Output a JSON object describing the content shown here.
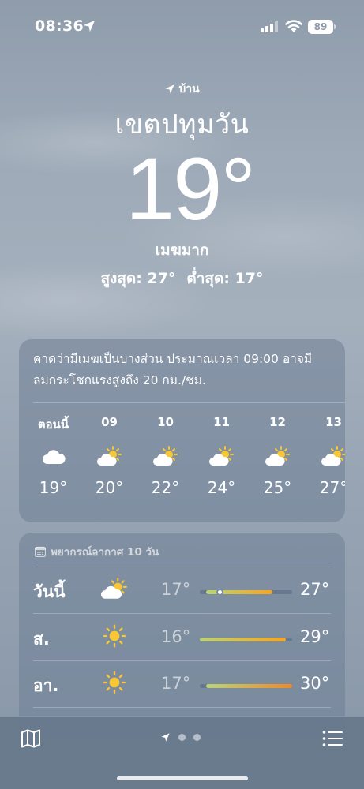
{
  "status_bar": {
    "time": "08:36",
    "battery": "89"
  },
  "header": {
    "location_label": "บ้าน",
    "city": "เขตปทุมวัน",
    "temperature": "19°",
    "condition": "เมฆมาก",
    "high": "สูงสุด: 27°",
    "low": "ต่ำสุด: 17°"
  },
  "hourly": {
    "summary_line1": "คาดว่ามีเมฆเป็นบางส่วน ประมาณเวลา 09:00 อาจมี",
    "summary_line2": "ลมกระโชกแรงสูงถึง 20 กม./ชม.",
    "hours": [
      {
        "label": "ตอนนี้",
        "icon": "cloud-icon",
        "temp": "19°"
      },
      {
        "label": "09",
        "icon": "partly-cloudy-icon",
        "temp": "20°"
      },
      {
        "label": "10",
        "icon": "partly-cloudy-icon",
        "temp": "22°"
      },
      {
        "label": "11",
        "icon": "partly-cloudy-icon",
        "temp": "24°"
      },
      {
        "label": "12",
        "icon": "partly-cloudy-icon",
        "temp": "25°"
      },
      {
        "label": "13",
        "icon": "partly-cloudy-icon",
        "temp": "27°"
      }
    ]
  },
  "daily": {
    "title": "พยากรณ์อากาศ 10 วัน",
    "range_min": 16,
    "range_max": 30,
    "days": [
      {
        "name": "วันนี้",
        "icon": "partly-cloudy-icon",
        "low": "17°",
        "high": "27°",
        "low_val": 17,
        "high_val": 27,
        "current_val": 19
      },
      {
        "name": "ส.",
        "icon": "sun-icon",
        "low": "16°",
        "high": "29°",
        "low_val": 16,
        "high_val": 29
      },
      {
        "name": "อา.",
        "icon": "sun-icon",
        "low": "17°",
        "high": "30°",
        "low_val": 17,
        "high_val": 30
      }
    ]
  },
  "colors": {
    "sun": "#f7c833",
    "bar_cool": "#b9d37a",
    "bar_warm": "#f5a524",
    "bar_hot": "#ee8a2a"
  }
}
